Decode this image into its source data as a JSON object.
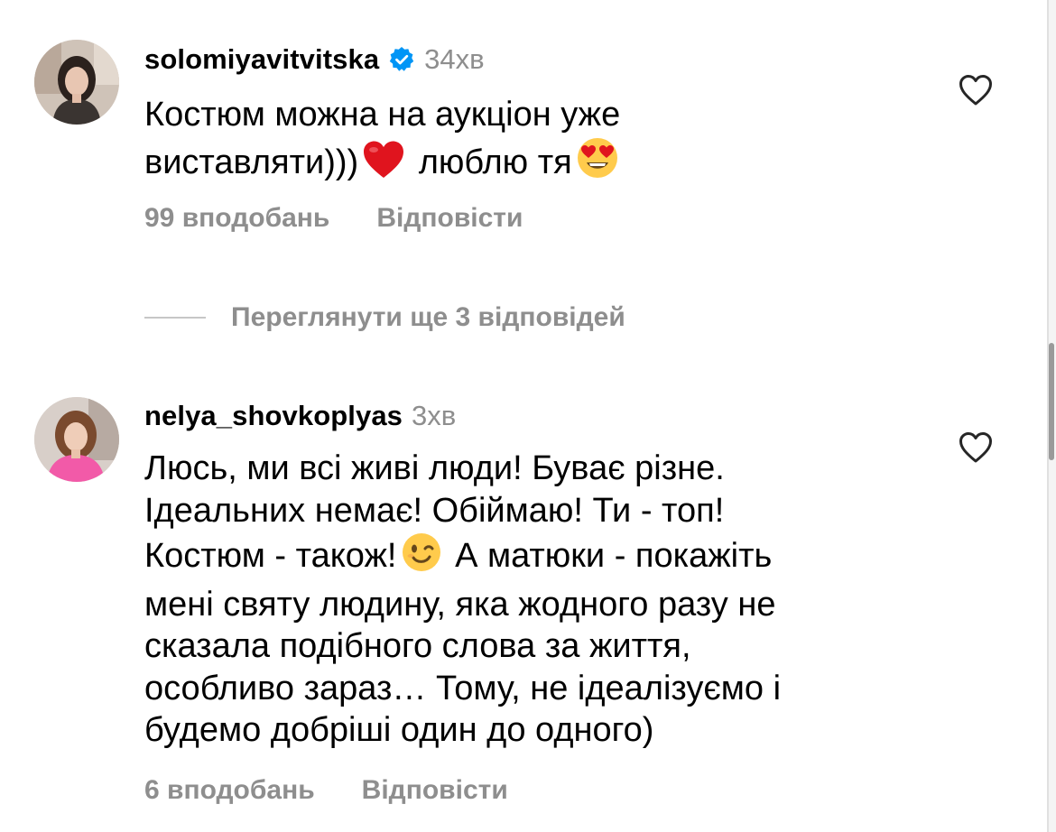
{
  "comments": [
    {
      "username": "solomiyavitvitska",
      "verified": true,
      "time": "34хв",
      "text_lines": [
        "Костюм можна на аукціон уже",
        "виставляти)))",
        "люблю тя"
      ],
      "likes_label": "99 вподобань",
      "reply_label": "Відповісти",
      "avatar_icon": "avatar-photo-woman-dark-hair",
      "like_icon": "heart-outline-icon"
    },
    {
      "username": "nelya_shovkoplyas",
      "verified": false,
      "time": "3хв",
      "text_lines": [
        "Люсь, ми всі живі люди! Буває різне.",
        "Ідеальних немає! Обіймаю! Ти - топ!",
        "Костюм - також!",
        "А матюки - покажіть",
        "мені святу людину, яка жодного разу не",
        "сказала подібного слова за життя,",
        "особливо зараз… Тому, не ідеалізуємо і",
        "будемо добріші один до одного)"
      ],
      "likes_label": "6 вподобань",
      "reply_label": "Відповісти",
      "avatar_icon": "avatar-photo-woman-pink",
      "like_icon": "heart-outline-icon"
    }
  ],
  "view_replies": {
    "label": "Переглянути ще 3 відповідей"
  },
  "emojis": {
    "red_heart": "red-heart-emoji",
    "heart_eyes": "heart-eyes-emoji",
    "wink": "winking-face-emoji"
  },
  "colors": {
    "text": "#000000",
    "muted": "#8e8e8e",
    "verified_blue": "#0095f6",
    "divider": "#c7c7c7",
    "heart_red": "#e0141e",
    "emoji_yellow": "#ffcb4c"
  }
}
